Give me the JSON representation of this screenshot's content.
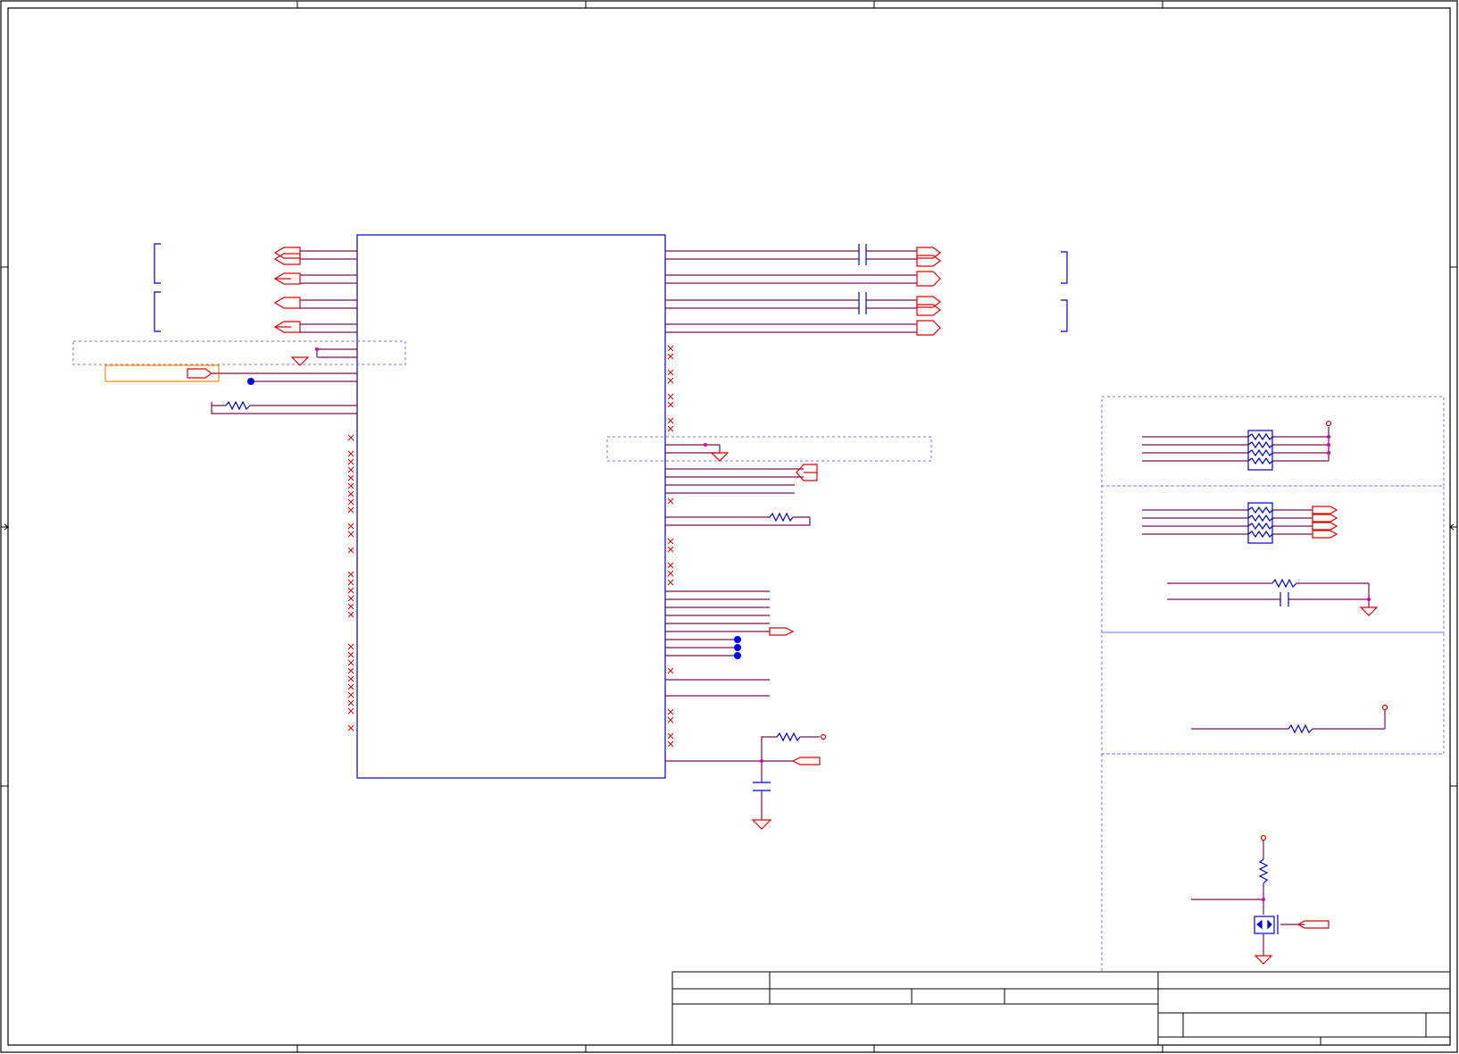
{
  "sheet": {
    "width": 1634,
    "height": 1180,
    "border_color": "#000000",
    "wire_color": "#7a1050",
    "component_color": "#0000cc",
    "port_color": "#e00000",
    "junction_color": "#cc00cc"
  },
  "title_block": {
    "title": "",
    "drawing_number": "",
    "sheet": "",
    "revision": ""
  }
}
